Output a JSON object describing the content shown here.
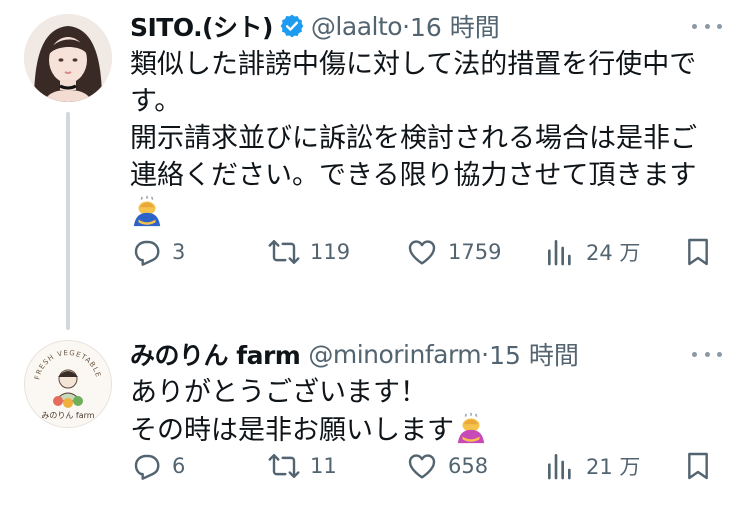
{
  "colors": {
    "text": "#0f1419",
    "secondary": "#536471",
    "verified": "#1d9bf0",
    "thread_line": "#cfd9de"
  },
  "tweets": [
    {
      "name": "SITO.(シト)",
      "verified": true,
      "handle": "@laalto",
      "dot": "·",
      "time": "16 時間",
      "lines": [
        "類似した誹謗中傷に対して法的措置を行使中で",
        "す。",
        "開示請求並びに訴訟を検討される場合は是非ご",
        "連絡ください。できる限り協力させて頂きます"
      ],
      "emoji": "person-bowing",
      "replies": "3",
      "retweets": "119",
      "likes": "1759",
      "views": "24 万"
    },
    {
      "name": "みのりん farm",
      "verified": false,
      "handle": "@minorinfarm",
      "dot": "·",
      "time": "15 時間",
      "lines": [
        "ありがとうございます！",
        "その時は是非お願いします"
      ],
      "emoji": "person-bowing",
      "avatar_text_top": "FRESH VEGETABLE",
      "avatar_text_bottom": "みのりん farm",
      "replies": "6",
      "retweets": "11",
      "likes": "658",
      "views": "21 万"
    }
  ]
}
